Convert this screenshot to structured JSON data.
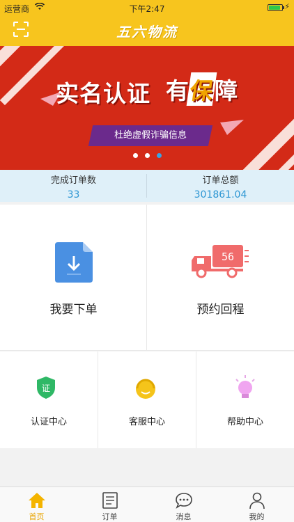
{
  "status_bar": {
    "carrier": "运营商",
    "time": "下午2:47"
  },
  "header": {
    "brand": "五六物流",
    "scan_icon": "scan-icon"
  },
  "banner": {
    "headline_left": "实名认证",
    "headline_right_prefix": "有",
    "headline_right_highlight": "保",
    "headline_right_suffix": "障",
    "subline": "杜绝虚假诈骗信息",
    "slide_count": 3,
    "active_slide": 3
  },
  "stats": {
    "completed_label": "完成订单数",
    "completed_value": "33",
    "amount_label": "订单总额",
    "amount_value": "301861.04"
  },
  "tiles": {
    "order": {
      "label": "我要下单",
      "icon": "download-doc-icon"
    },
    "return_trip": {
      "label": "预约回程",
      "icon": "truck-icon",
      "truck_badge": "56"
    }
  },
  "shortcuts": {
    "auth": {
      "label": "认证中心",
      "icon": "shield-icon",
      "badge": "证"
    },
    "service": {
      "label": "客服中心",
      "icon": "headset-icon"
    },
    "help": {
      "label": "帮助中心",
      "icon": "lightbulb-icon"
    }
  },
  "tabbar": {
    "home": "首页",
    "orders": "订单",
    "messages": "消息",
    "mine": "我的",
    "active": "home"
  },
  "colors": {
    "brand_yellow": "#f7c51e",
    "banner_red": "#d32a17",
    "stat_blue": "#2d96d3",
    "active_tab": "#e8a400"
  }
}
